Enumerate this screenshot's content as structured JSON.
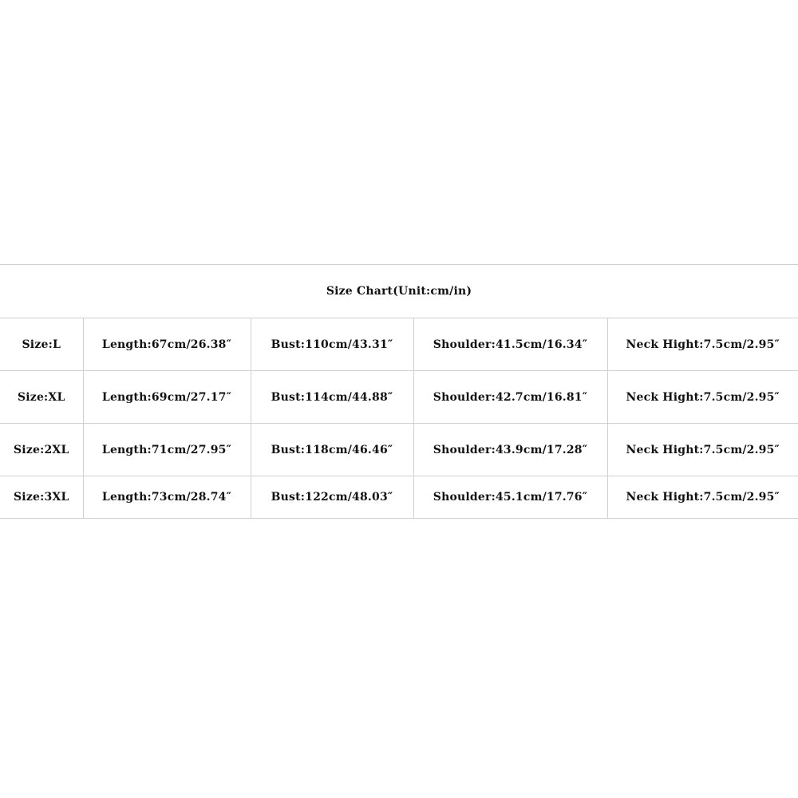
{
  "title": "Size Chart(Unit:cm/in)",
  "rows": [
    {
      "size": "Size:L",
      "length": "Length:67cm/26.38″",
      "bust": "Bust:110cm/43.31″",
      "shoulder": "Shoulder:41.5cm/16.34″",
      "neck": "Neck Hight:7.5cm/2.95″"
    },
    {
      "size": "Size:XL",
      "length": "Length:69cm/27.17″",
      "bust": "Bust:114cm/44.88″",
      "shoulder": "Shoulder:42.7cm/16.81″",
      "neck": "Neck Hight:7.5cm/2.95″"
    },
    {
      "size": "Size:2XL",
      "length": "Length:71cm/27.95″",
      "bust": "Bust:118cm/46.46″",
      "shoulder": "Shoulder:43.9cm/17.28″",
      "neck": "Neck Hight:7.5cm/2.95″"
    },
    {
      "size": "Size:3XL",
      "length": "Length:73cm/28.74″",
      "bust": "Bust:122cm/48.03″",
      "shoulder": "Shoulder:45.1cm/17.76″",
      "neck": "Neck Hight:7.5cm/2.95″"
    }
  ]
}
